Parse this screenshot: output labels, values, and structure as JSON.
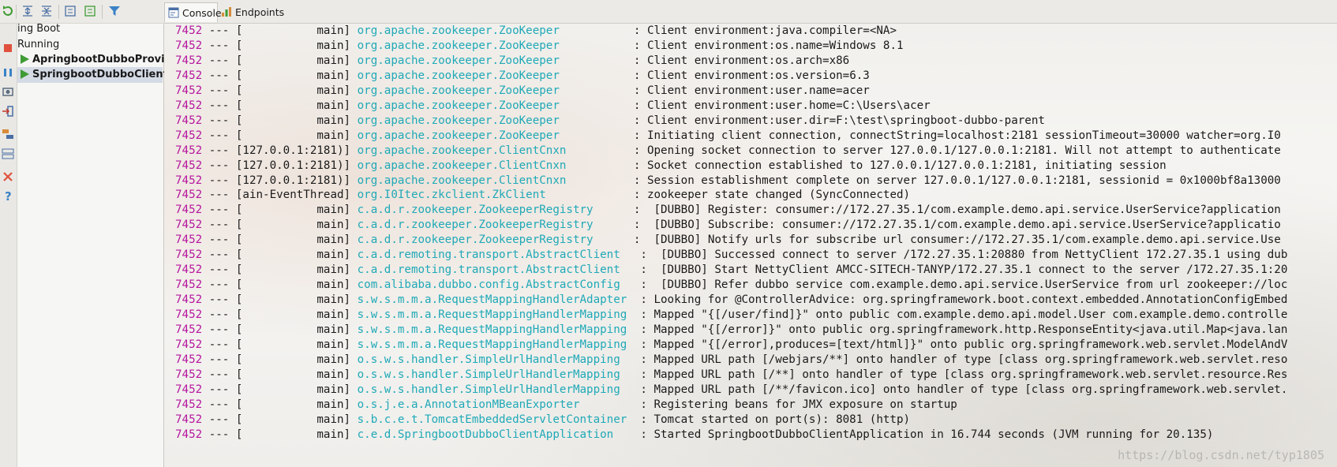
{
  "sidebar_tree": {
    "root_label": "ing Boot",
    "running_label": "Running",
    "apps": [
      {
        "label": "ApringbootDubboProvide"
      },
      {
        "label": "SpringbootDubboClientAp"
      }
    ]
  },
  "tabs": [
    {
      "label": "Console"
    },
    {
      "label": "Endpoints"
    }
  ],
  "console": {
    "lines": [
      {
        "pid": "7452",
        "sep": " --- [",
        "thread": "           main] ",
        "logger": "org.apache.zookeeper.ZooKeeper           ",
        "msg": ": Client environment:java.compiler=<NA>"
      },
      {
        "pid": "7452",
        "sep": " --- [",
        "thread": "           main] ",
        "logger": "org.apache.zookeeper.ZooKeeper           ",
        "msg": ": Client environment:os.name=Windows 8.1"
      },
      {
        "pid": "7452",
        "sep": " --- [",
        "thread": "           main] ",
        "logger": "org.apache.zookeeper.ZooKeeper           ",
        "msg": ": Client environment:os.arch=x86"
      },
      {
        "pid": "7452",
        "sep": " --- [",
        "thread": "           main] ",
        "logger": "org.apache.zookeeper.ZooKeeper           ",
        "msg": ": Client environment:os.version=6.3"
      },
      {
        "pid": "7452",
        "sep": " --- [",
        "thread": "           main] ",
        "logger": "org.apache.zookeeper.ZooKeeper           ",
        "msg": ": Client environment:user.name=acer"
      },
      {
        "pid": "7452",
        "sep": " --- [",
        "thread": "           main] ",
        "logger": "org.apache.zookeeper.ZooKeeper           ",
        "msg": ": Client environment:user.home=C:\\Users\\acer"
      },
      {
        "pid": "7452",
        "sep": " --- [",
        "thread": "           main] ",
        "logger": "org.apache.zookeeper.ZooKeeper           ",
        "msg": ": Client environment:user.dir=F:\\test\\springboot-dubbo-parent"
      },
      {
        "pid": "7452",
        "sep": " --- [",
        "thread": "           main] ",
        "logger": "org.apache.zookeeper.ZooKeeper           ",
        "msg": ": Initiating client connection, connectString=localhost:2181 sessionTimeout=30000 watcher=org.I0"
      },
      {
        "pid": "7452",
        "sep": " --- [",
        "thread": "127.0.0.1:2181)] ",
        "logger": "org.apache.zookeeper.ClientCnxn          ",
        "msg": ": Opening socket connection to server 127.0.0.1/127.0.0.1:2181. Will not attempt to authenticate"
      },
      {
        "pid": "7452",
        "sep": " --- [",
        "thread": "127.0.0.1:2181)] ",
        "logger": "org.apache.zookeeper.ClientCnxn          ",
        "msg": ": Socket connection established to 127.0.0.1/127.0.0.1:2181, initiating session"
      },
      {
        "pid": "7452",
        "sep": " --- [",
        "thread": "127.0.0.1:2181)] ",
        "logger": "org.apache.zookeeper.ClientCnxn          ",
        "msg": ": Session establishment complete on server 127.0.0.1/127.0.0.1:2181, sessionid = 0x1000bf8a13000"
      },
      {
        "pid": "7452",
        "sep": " --- [",
        "thread": "ain-EventThread] ",
        "logger": "org.I0Itec.zkclient.ZkClient             ",
        "msg": ": zookeeper state changed (SyncConnected)"
      },
      {
        "pid": "7452",
        "sep": " --- [",
        "thread": "           main] ",
        "logger": "c.a.d.r.zookeeper.ZookeeperRegistry      ",
        "msg": ":  [DUBBO] Register: consumer://172.27.35.1/com.example.demo.api.service.UserService?application"
      },
      {
        "pid": "7452",
        "sep": " --- [",
        "thread": "           main] ",
        "logger": "c.a.d.r.zookeeper.ZookeeperRegistry      ",
        "msg": ":  [DUBBO] Subscribe: consumer://172.27.35.1/com.example.demo.api.service.UserService?applicatio"
      },
      {
        "pid": "7452",
        "sep": " --- [",
        "thread": "           main] ",
        "logger": "c.a.d.r.zookeeper.ZookeeperRegistry      ",
        "msg": ":  [DUBBO] Notify urls for subscribe url consumer://172.27.35.1/com.example.demo.api.service.Use"
      },
      {
        "pid": "7452",
        "sep": " --- [",
        "thread": "           main] ",
        "logger": "c.a.d.remoting.transport.AbstractClient   ",
        "msg": ":  [DUBBO] Successed connect to server /172.27.35.1:20880 from NettyClient 172.27.35.1 using dub"
      },
      {
        "pid": "7452",
        "sep": " --- [",
        "thread": "           main] ",
        "logger": "c.a.d.remoting.transport.AbstractClient   ",
        "msg": ":  [DUBBO] Start NettyClient AMCC-SITECH-TANYP/172.27.35.1 connect to the server /172.27.35.1:20"
      },
      {
        "pid": "7452",
        "sep": " --- [",
        "thread": "           main] ",
        "logger": "com.alibaba.dubbo.config.AbstractConfig   ",
        "msg": ":  [DUBBO] Refer dubbo service com.example.demo.api.service.UserService from url zookeeper://loc"
      },
      {
        "pid": "7452",
        "sep": " --- [",
        "thread": "           main] ",
        "logger": "s.w.s.m.m.a.RequestMappingHandlerAdapter  ",
        "msg": ": Looking for @ControllerAdvice: org.springframework.boot.context.embedded.AnnotationConfigEmbed"
      },
      {
        "pid": "7452",
        "sep": " --- [",
        "thread": "           main] ",
        "logger": "s.w.s.m.m.a.RequestMappingHandlerMapping  ",
        "msg": ": Mapped \"{[/user/find]}\" onto public com.example.demo.api.model.User com.example.demo.controlle"
      },
      {
        "pid": "7452",
        "sep": " --- [",
        "thread": "           main] ",
        "logger": "s.w.s.m.m.a.RequestMappingHandlerMapping  ",
        "msg": ": Mapped \"{[/error]}\" onto public org.springframework.http.ResponseEntity<java.util.Map<java.lan"
      },
      {
        "pid": "7452",
        "sep": " --- [",
        "thread": "           main] ",
        "logger": "s.w.s.m.m.a.RequestMappingHandlerMapping  ",
        "msg": ": Mapped \"{[/error],produces=[text/html]}\" onto public org.springframework.web.servlet.ModelAndV"
      },
      {
        "pid": "7452",
        "sep": " --- [",
        "thread": "           main] ",
        "logger": "o.s.w.s.handler.SimpleUrlHandlerMapping   ",
        "msg": ": Mapped URL path [/webjars/**] onto handler of type [class org.springframework.web.servlet.reso"
      },
      {
        "pid": "7452",
        "sep": " --- [",
        "thread": "           main] ",
        "logger": "o.s.w.s.handler.SimpleUrlHandlerMapping   ",
        "msg": ": Mapped URL path [/**] onto handler of type [class org.springframework.web.servlet.resource.Res"
      },
      {
        "pid": "7452",
        "sep": " --- [",
        "thread": "           main] ",
        "logger": "o.s.w.s.handler.SimpleUrlHandlerMapping   ",
        "msg": ": Mapped URL path [/**/favicon.ico] onto handler of type [class org.springframework.web.servlet."
      },
      {
        "pid": "7452",
        "sep": " --- [",
        "thread": "           main] ",
        "logger": "o.s.j.e.a.AnnotationMBeanExporter         ",
        "msg": ": Registering beans for JMX exposure on startup"
      },
      {
        "pid": "7452",
        "sep": " --- [",
        "thread": "           main] ",
        "logger": "s.b.c.e.t.TomcatEmbeddedServletContainer  ",
        "msg": ": Tomcat started on port(s): 8081 (http)"
      },
      {
        "pid": "7452",
        "sep": " --- [",
        "thread": "           main] ",
        "logger": "c.e.d.SpringbootDubboClientApplication    ",
        "msg": ": Started SpringbootDubboClientApplication in 16.744 seconds (JVM running for 20.135)"
      }
    ],
    "watermark": "https://blog.csdn.net/typ1805"
  },
  "colors": {
    "pid": "#b5179e",
    "logger": "#1fa9b7",
    "run_arrow": "#3f9c35",
    "selection": "#d5dbe5"
  }
}
